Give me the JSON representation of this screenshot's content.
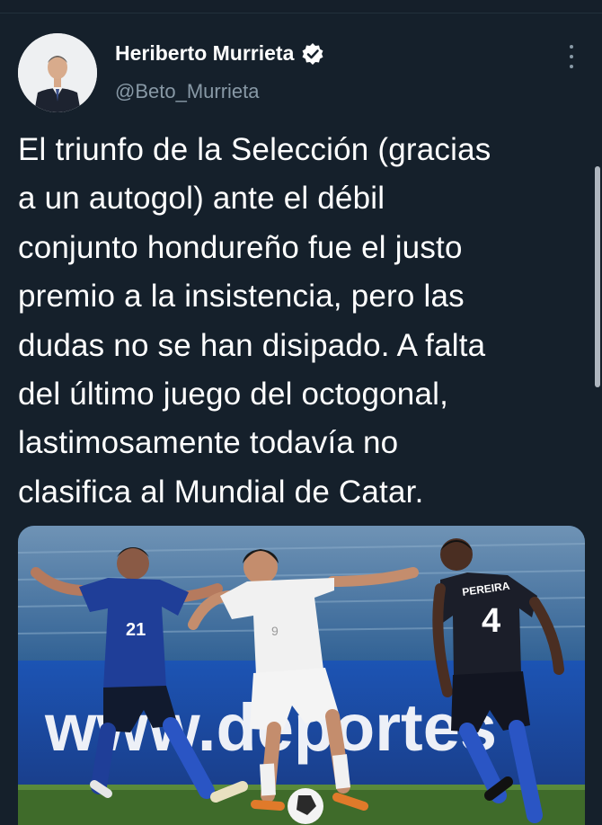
{
  "author": {
    "name": "Heriberto Murrieta",
    "handle": "@Beto_Murrieta",
    "verified": true
  },
  "icons": {
    "verified": "verified-badge-icon",
    "more": "more-vertical-icon"
  },
  "tweet": {
    "text": "El triunfo de la Selección (gracias\na un autogol) ante el débil\nconjunto hondureño fue el justo\npremio a la insistencia, pero las\ndudas no se han disipado. A falta\ndel último juego del octogonal,\nlastimosamente todavía no\nclasifica al Mundial de Catar."
  },
  "media": {
    "banner_text": "www.deportes",
    "players": [
      {
        "jersey_number": "21"
      },
      {
        "jersey_number": "9"
      },
      {
        "jersey_name": "PEREIRA",
        "jersey_number": "4"
      }
    ]
  },
  "colors": {
    "background": "#15202b",
    "text": "#ffffff",
    "secondary_text": "#8899a6"
  }
}
